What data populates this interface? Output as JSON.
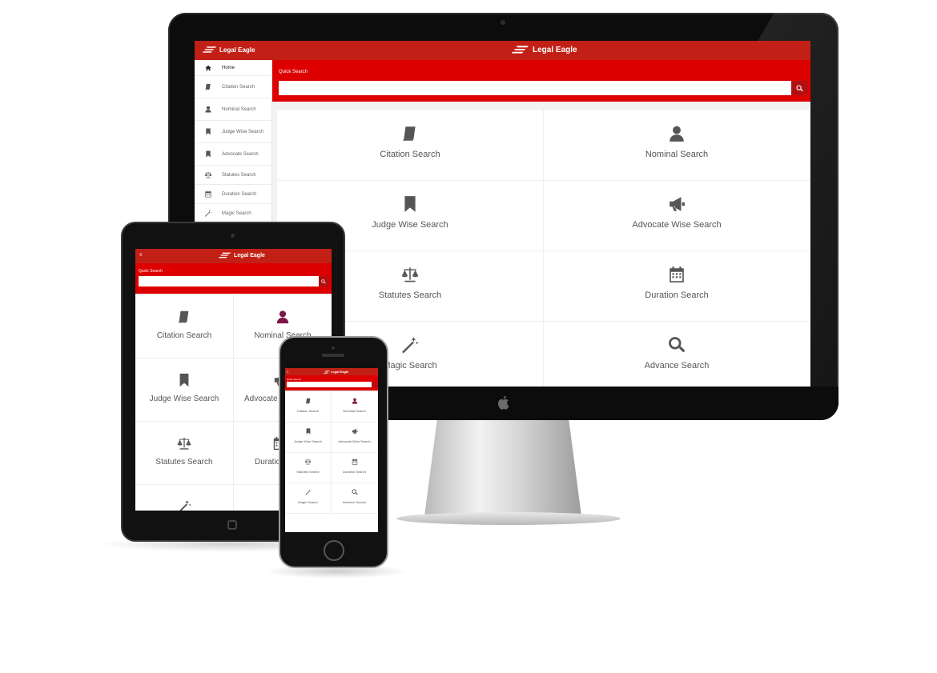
{
  "brand": {
    "name": "Legal Eagle"
  },
  "colors": {
    "header": "#c22016",
    "search_band": "#dc0000",
    "accent_purple": "#7b1646"
  },
  "desktop": {
    "sidebar": [
      {
        "icon": "home-icon",
        "label": "Home"
      },
      {
        "icon": "book-icon",
        "label": "Citation Search"
      },
      {
        "icon": "user-icon",
        "label": "Nominal Search"
      },
      {
        "icon": "bookmark-icon",
        "label": "Judge Wise Search"
      },
      {
        "icon": "bookmark-icon",
        "label": "Advocate Search"
      },
      {
        "icon": "scale-icon",
        "label": "Statutes Search"
      },
      {
        "icon": "calendar-icon",
        "label": "Duration Search"
      },
      {
        "icon": "magic-wand-icon",
        "label": "Magic Search"
      }
    ],
    "quick_search": {
      "label": "Quick Search",
      "placeholder": ""
    },
    "tiles": [
      {
        "icon": "book-icon",
        "label": "Citation Search"
      },
      {
        "icon": "user-icon",
        "label": "Nominal Search"
      },
      {
        "icon": "bookmark-icon",
        "label": "Judge Wise Search"
      },
      {
        "icon": "megaphone-icon",
        "label": "Advocate Wise Search"
      },
      {
        "icon": "scale-icon",
        "label": "Statutes Search"
      },
      {
        "icon": "calendar-icon",
        "label": "Duration Search"
      },
      {
        "icon": "magic-wand-icon",
        "label": "Magic Search"
      },
      {
        "icon": "search-icon",
        "label": "Advance Search"
      }
    ]
  },
  "tablet": {
    "quick_search": {
      "label": "Quick Search"
    },
    "tiles": [
      {
        "icon": "book-icon",
        "label": "Citation Search"
      },
      {
        "icon": "user-icon",
        "label": "Nominal Search"
      },
      {
        "icon": "bookmark-icon",
        "label": "Judge Wise Search"
      },
      {
        "icon": "megaphone-icon",
        "label": "Advocate"
      },
      {
        "icon": "scale-icon",
        "label": "Statutes Search"
      },
      {
        "icon": "calendar-icon",
        "label": "Duratio"
      }
    ]
  },
  "phone": {
    "quick_search": {
      "label": "Quick Search"
    },
    "tiles": [
      {
        "icon": "book-icon",
        "label": "Citation Search"
      },
      {
        "icon": "user-icon",
        "label": "Nominal Search"
      },
      {
        "icon": "bookmark-icon",
        "label": "Judge Wise Search"
      },
      {
        "icon": "megaphone-icon",
        "label": "Advocate Wise Search"
      },
      {
        "icon": "scale-icon",
        "label": "Statutes Search"
      },
      {
        "icon": "calendar-icon",
        "label": "Duration Search"
      },
      {
        "icon": "magic-wand-icon",
        "label": "Magic Search"
      },
      {
        "icon": "search-icon",
        "label": "Advance Search"
      }
    ]
  }
}
